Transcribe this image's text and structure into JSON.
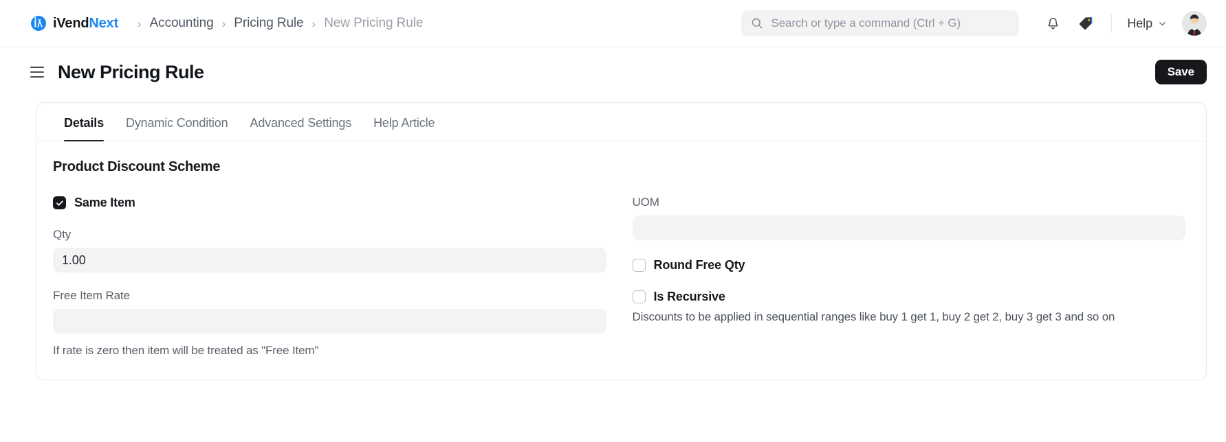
{
  "navbar": {
    "brand": {
      "part1": "iVend",
      "part2": "Next",
      "logo_icon": "ivend-logo-icon"
    },
    "breadcrumb": {
      "separator": "›",
      "items": [
        {
          "label": "Accounting",
          "current": false
        },
        {
          "label": "Pricing Rule",
          "current": false
        },
        {
          "label": "New Pricing Rule",
          "current": true
        }
      ]
    },
    "search": {
      "placeholder": "Search or type a command (Ctrl + G)",
      "value": "",
      "icon": "search-icon"
    },
    "notifications_icon": "bell-icon",
    "tags_icon": "tag-icon",
    "help": {
      "label": "Help",
      "chevron_icon": "chevron-down-icon"
    },
    "avatar": {
      "icon": "user-avatar"
    }
  },
  "page_head": {
    "menu_icon": "hamburger-menu-icon",
    "title": "New Pricing Rule",
    "save_label": "Save"
  },
  "tabs": [
    {
      "label": "Details",
      "active": true
    },
    {
      "label": "Dynamic Condition",
      "active": false
    },
    {
      "label": "Advanced Settings",
      "active": false
    },
    {
      "label": "Help Article",
      "active": false
    }
  ],
  "form": {
    "section_title": "Product Discount Scheme",
    "left": {
      "same_item": {
        "label": "Same Item",
        "checked": true
      },
      "qty": {
        "label": "Qty",
        "value": "1.00",
        "placeholder": ""
      },
      "free_item_rate": {
        "label": "Free Item Rate",
        "value": "",
        "placeholder": ""
      },
      "free_item_rate_hint": "If rate is zero then item will be treated as \"Free Item\""
    },
    "right": {
      "uom": {
        "label": "UOM",
        "value": "",
        "placeholder": ""
      },
      "round_free_qty": {
        "label": "Round Free Qty",
        "checked": false
      },
      "is_recursive": {
        "label": "Is Recursive",
        "checked": false
      },
      "is_recursive_hint": "Discounts to be applied in sequential ranges like buy 1 get 1, buy 2 get 2, buy 3 get 3 and so on"
    }
  },
  "colors": {
    "accent": "#1a87f2",
    "text_primary": "#16181c",
    "text_muted": "#6d747e",
    "input_bg": "#f3f3f4",
    "button_dark": "#17181b"
  }
}
